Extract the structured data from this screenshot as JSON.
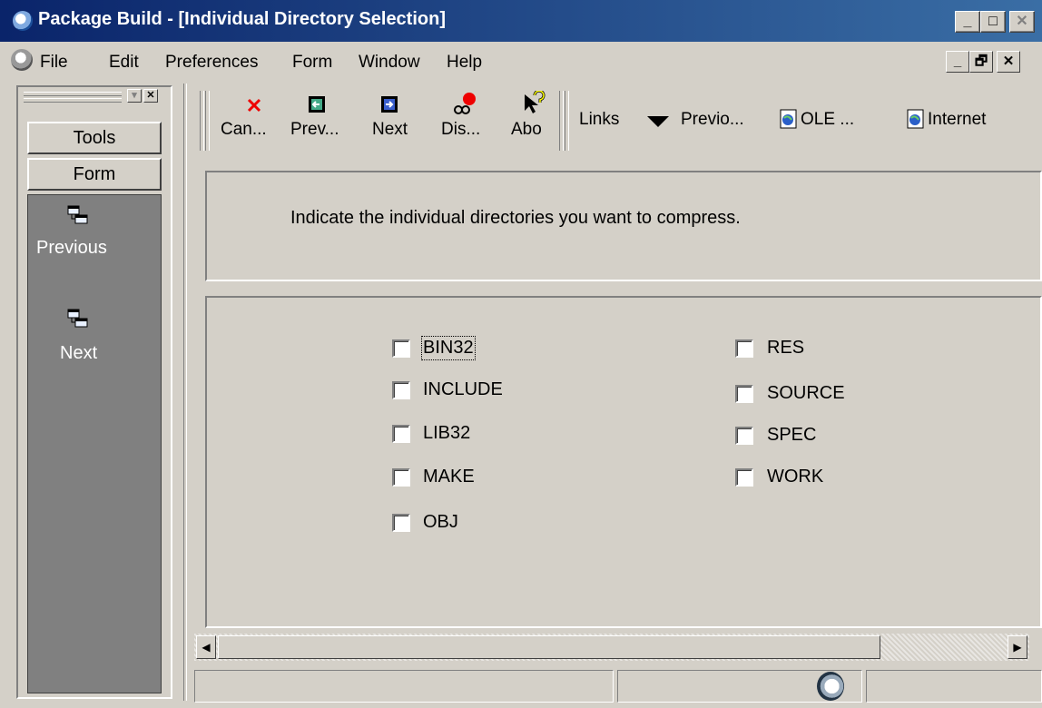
{
  "window": {
    "title": "Package Build - [Individual Directory Selection]",
    "controls": {
      "minimize": "_",
      "maximize": "□",
      "close": "✕"
    }
  },
  "menubar": {
    "items": [
      "File",
      "Edit",
      "Preferences",
      "Form",
      "Window",
      "Help"
    ],
    "mdi_controls": {
      "minimize": "_",
      "restore": "🗗",
      "close": "✕"
    }
  },
  "left_pane": {
    "sections": [
      {
        "label": "Tools"
      },
      {
        "label": "Form"
      }
    ],
    "items": [
      {
        "label": "Previous",
        "icon": "previous-form-icon"
      },
      {
        "label": "Next",
        "icon": "next-form-icon"
      }
    ]
  },
  "toolbar": {
    "buttons": [
      {
        "label": "Can...",
        "icon": "cancel-x-icon"
      },
      {
        "label": "Prev...",
        "icon": "previous-arrow-icon"
      },
      {
        "label": "Next",
        "icon": "next-arrow-icon"
      },
      {
        "label": "Dis...",
        "icon": "display-errors-icon"
      },
      {
        "label": "Abo",
        "icon": "about-help-icon"
      }
    ],
    "links": {
      "label": "Links",
      "items": [
        {
          "label": "Previo...",
          "icon": "dropdown-arrow-icon"
        },
        {
          "label": "OLE ...",
          "icon": "ole-document-icon"
        },
        {
          "label": "Internet",
          "icon": "internet-document-icon"
        }
      ]
    }
  },
  "main": {
    "instruction": "Indicate the individual directories you want to compress.",
    "checkboxes_left": [
      {
        "label": "BIN32",
        "checked": false,
        "focused": true
      },
      {
        "label": "INCLUDE",
        "checked": false
      },
      {
        "label": "LIB32",
        "checked": false
      },
      {
        "label": "MAKE",
        "checked": false
      },
      {
        "label": "OBJ",
        "checked": false
      }
    ],
    "checkboxes_right": [
      {
        "label": "RES",
        "checked": false
      },
      {
        "label": "SOURCE",
        "checked": false
      },
      {
        "label": "SPEC",
        "checked": false
      },
      {
        "label": "WORK",
        "checked": false
      }
    ]
  },
  "scrollbar": {
    "left_arrow": "◀",
    "right_arrow": "▶"
  },
  "colors": {
    "title_bar": "#0a246a",
    "nav_background": "#808080",
    "face": "#d4d0c8"
  }
}
